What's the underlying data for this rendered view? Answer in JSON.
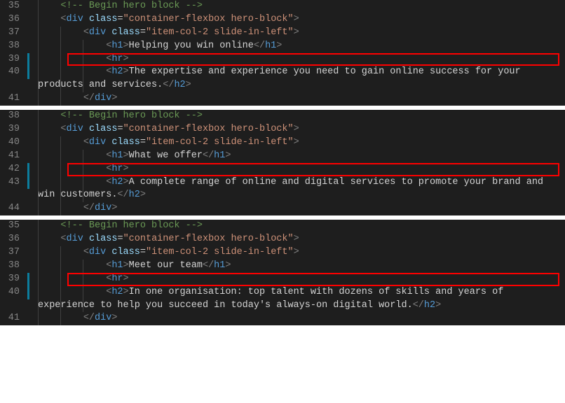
{
  "blocks": [
    {
      "lines": [
        {
          "num": "35",
          "indent": 1,
          "kind": "comment",
          "comment": "<!-- Begin hero block -->"
        },
        {
          "num": "36",
          "indent": 1,
          "kind": "open",
          "tag": "div",
          "attrs": [
            [
              "class",
              "container-flexbox hero-block"
            ]
          ]
        },
        {
          "num": "37",
          "indent": 2,
          "kind": "open",
          "tag": "div",
          "attrs": [
            [
              "class",
              "item-col-2 slide-in-left"
            ]
          ]
        },
        {
          "num": "38",
          "indent": 3,
          "kind": "elem",
          "tag": "h1",
          "text": "Helping you win online"
        },
        {
          "num": "39",
          "indent": 3,
          "kind": "void",
          "tag": "hr",
          "highlight": true,
          "marker": true
        },
        {
          "num": "40",
          "indent": 3,
          "kind": "elem",
          "tag": "h2",
          "text": "The expertise and experience you need to gain online success for your products and services.",
          "marker": true
        },
        {
          "num": "41",
          "indent": 2,
          "kind": "close",
          "tag": "div"
        }
      ]
    },
    {
      "lines": [
        {
          "num": "38",
          "indent": 1,
          "kind": "comment",
          "comment": "<!-- Begin hero block -->"
        },
        {
          "num": "39",
          "indent": 1,
          "kind": "open",
          "tag": "div",
          "attrs": [
            [
              "class",
              "container-flexbox hero-block"
            ]
          ]
        },
        {
          "num": "40",
          "indent": 2,
          "kind": "open",
          "tag": "div",
          "attrs": [
            [
              "class",
              "item-col-2 slide-in-left"
            ]
          ]
        },
        {
          "num": "41",
          "indent": 3,
          "kind": "elem",
          "tag": "h1",
          "text": "What we offer"
        },
        {
          "num": "42",
          "indent": 3,
          "kind": "void",
          "tag": "hr",
          "highlight": true,
          "marker": true
        },
        {
          "num": "43",
          "indent": 3,
          "kind": "elem",
          "tag": "h2",
          "text": "A complete range of online and digital services to promote your brand and win customers.",
          "marker": true
        },
        {
          "num": "44",
          "indent": 2,
          "kind": "close",
          "tag": "div"
        }
      ]
    },
    {
      "lines": [
        {
          "num": "35",
          "indent": 1,
          "kind": "comment",
          "comment": "<!-- Begin hero block -->"
        },
        {
          "num": "36",
          "indent": 1,
          "kind": "open",
          "tag": "div",
          "attrs": [
            [
              "class",
              "container-flexbox hero-block"
            ]
          ]
        },
        {
          "num": "37",
          "indent": 2,
          "kind": "open",
          "tag": "div",
          "attrs": [
            [
              "class",
              "item-col-2 slide-in-left"
            ]
          ]
        },
        {
          "num": "38",
          "indent": 3,
          "kind": "elem",
          "tag": "h1",
          "text": "Meet our team"
        },
        {
          "num": "39",
          "indent": 3,
          "kind": "void",
          "tag": "hr",
          "highlight": true,
          "marker": true
        },
        {
          "num": "40",
          "indent": 3,
          "kind": "elem",
          "tag": "h2",
          "text": "In one organisation: top talent with dozens of skills and years of experience to help you succeed in today's always-on digital world.",
          "marker": true
        },
        {
          "num": "41",
          "indent": 2,
          "kind": "close",
          "tag": "div"
        }
      ]
    }
  ]
}
